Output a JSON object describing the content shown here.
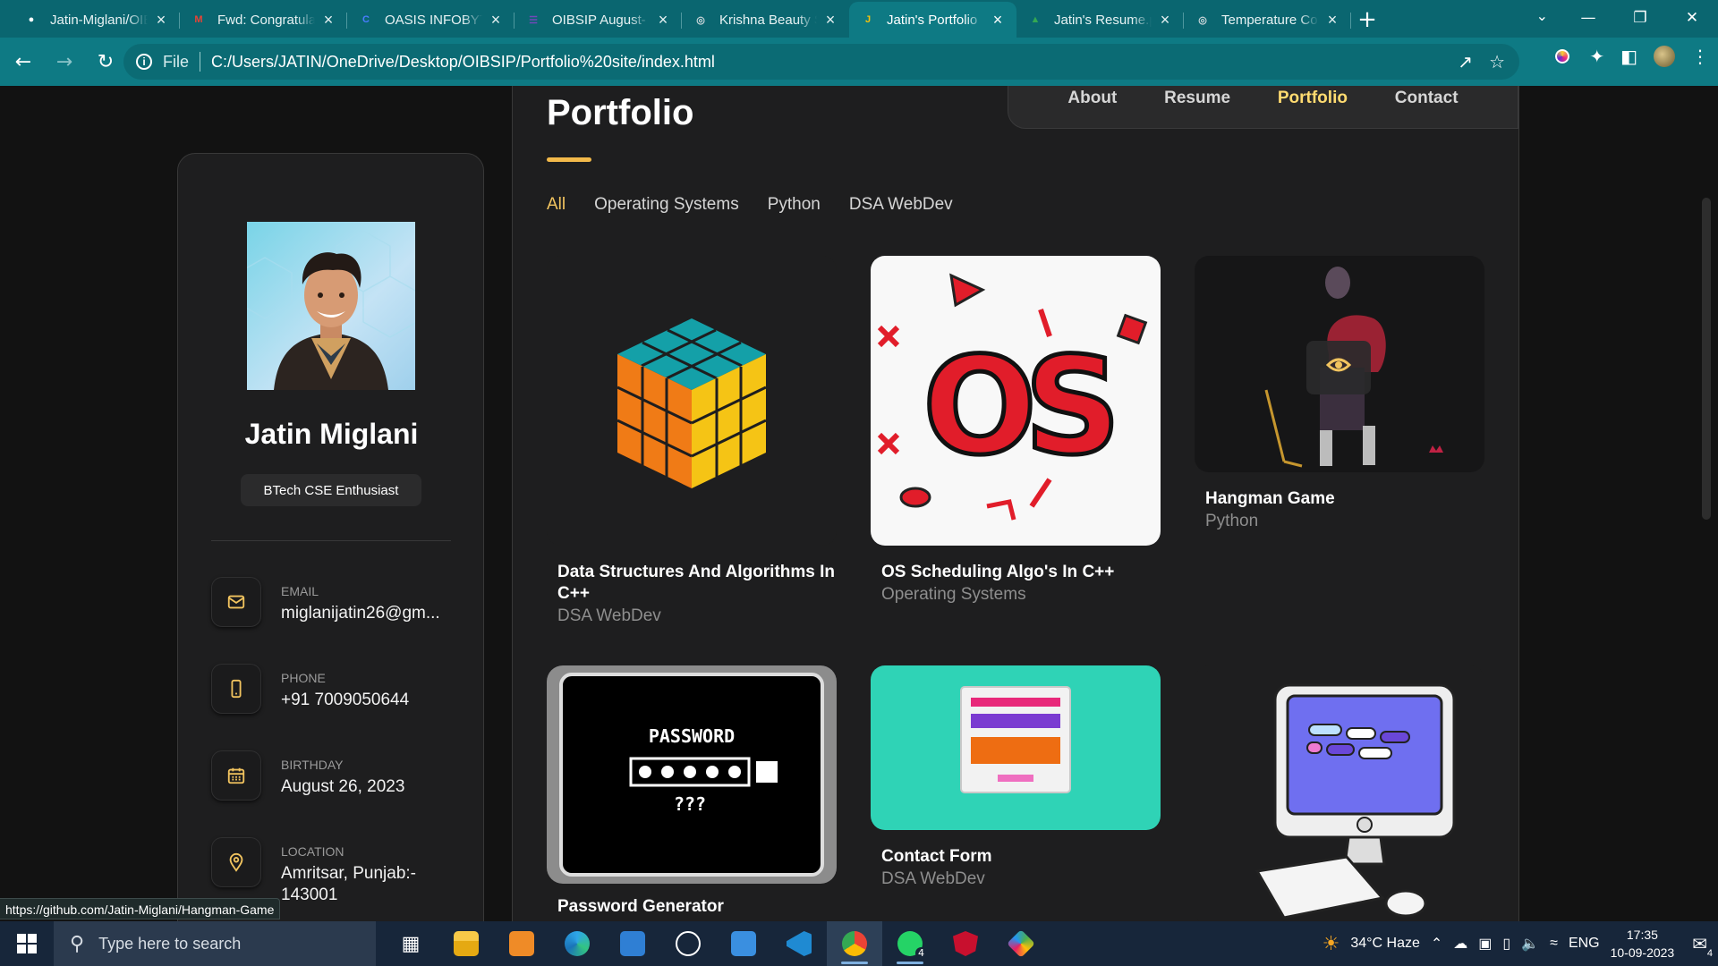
{
  "browser": {
    "tabs": [
      {
        "label": "Jatin-Miglani/OIB",
        "icon": "github-icon",
        "color": "#ffffff"
      },
      {
        "label": "Fwd: Congratulati",
        "icon": "gmail-icon",
        "color": "#ea4335"
      },
      {
        "label": "OASIS INFOBYTE",
        "icon": "canva-icon",
        "color": "#4a7dff"
      },
      {
        "label": "OIBSIP August- P",
        "icon": "forms-icon",
        "color": "#7248b9"
      },
      {
        "label": "Krishna Beauty Sa",
        "icon": "globe-icon",
        "color": "#cfd8dc"
      },
      {
        "label": "Jatin's Portfolio",
        "icon": "portfolio-icon",
        "color": "#f4c20d"
      },
      {
        "label": "Jatin's Resume.pd",
        "icon": "drive-icon",
        "color": "#34a853"
      },
      {
        "label": "Temperature Con",
        "icon": "globe-icon",
        "color": "#cfd8dc"
      }
    ],
    "active_tab": 5,
    "file_label": "File",
    "url": "C:/Users/JATIN/OneDrive/Desktop/OIBSIP/Portfolio%20site/index.html",
    "accent": "#0e7a84"
  },
  "sidebar": {
    "name": "Jatin Miglani",
    "title": "BTech CSE Enthusiast",
    "contacts": [
      {
        "label": "EMAIL",
        "value": "miglanijatin26@gm...",
        "icon": "mail-icon"
      },
      {
        "label": "PHONE",
        "value": "+91 7009050644",
        "icon": "phone-icon"
      },
      {
        "label": "BIRTHDAY",
        "value": "August 26, 2023",
        "icon": "calendar-icon"
      },
      {
        "label": "LOCATION",
        "value": "Amritsar, Punjab:-",
        "value2": "143001",
        "icon": "location-icon"
      }
    ]
  },
  "nav": {
    "items": [
      "About",
      "Resume",
      "Portfolio",
      "Contact"
    ],
    "active": 2
  },
  "portfolio": {
    "heading": "Portfolio",
    "filters": [
      "All",
      "Operating Systems",
      "Python",
      "DSA WebDev"
    ],
    "active_filter": 0,
    "projects": [
      {
        "title": "Data Structures And Algorithms In C++",
        "category": "DSA WebDev",
        "art": "rubiks-cube"
      },
      {
        "title": "OS Scheduling Algo's In C++",
        "category": "Operating Systems",
        "art": "os-logo"
      },
      {
        "title": "Hangman Game",
        "category": "Python",
        "art": "hangman"
      },
      {
        "title": "Password Generator",
        "category": "",
        "art": "password"
      },
      {
        "title": "Contact Form",
        "category": "DSA WebDev",
        "art": "contact-form"
      },
      {
        "title": "",
        "category": "",
        "art": "computer"
      }
    ],
    "password_art": {
      "word": "PASSWORD",
      "hint": "???"
    }
  },
  "status_url": "https://github.com/Jatin-Miglani/Hangman-Game",
  "taskbar": {
    "search_placeholder": "Type here to search",
    "weather": "34°C Haze",
    "lang": "ENG",
    "time": "17:35",
    "date": "10-09-2023",
    "whatsapp_badge": "4",
    "notif_badge": "4"
  }
}
